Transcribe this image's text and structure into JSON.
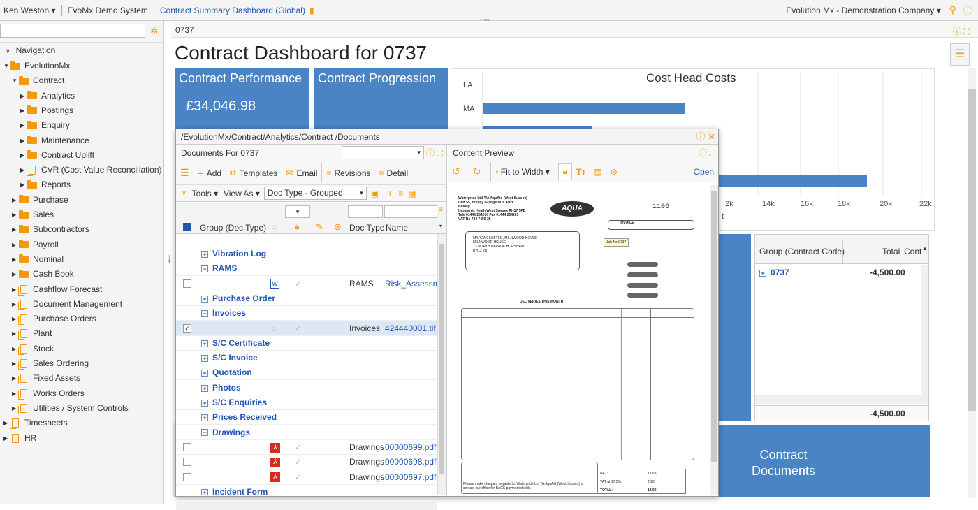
{
  "topbar": {
    "user": "Ken Weston",
    "system": "EvoMx Demo System",
    "dashboard": "Contract Summary Dashboard (Global)",
    "company": "Evolution Mx - Demonstration Company"
  },
  "sidebar": {
    "nav_header": "Navigation",
    "items": [
      {
        "label": "EvolutionMx"
      },
      {
        "label": "Contract"
      },
      {
        "label": "Analytics"
      },
      {
        "label": "Postings"
      },
      {
        "label": "Enquiry"
      },
      {
        "label": "Maintenance"
      },
      {
        "label": "Contract Uplift"
      },
      {
        "label": "CVR (Cost Value Reconciliation)"
      },
      {
        "label": "Reports"
      },
      {
        "label": "Purchase"
      },
      {
        "label": "Sales"
      },
      {
        "label": "Subcontractors"
      },
      {
        "label": "Payroll"
      },
      {
        "label": "Nominal"
      },
      {
        "label": "Cash Book"
      },
      {
        "label": "Cashflow Forecast"
      },
      {
        "label": "Document Management"
      },
      {
        "label": "Purchase Orders"
      },
      {
        "label": "Plant"
      },
      {
        "label": "Stock"
      },
      {
        "label": "Sales Ordering"
      },
      {
        "label": "Fixed Assets"
      },
      {
        "label": "Works Orders"
      },
      {
        "label": "Utilities / System Controls"
      },
      {
        "label": "Timesheets"
      },
      {
        "label": "HR"
      }
    ]
  },
  "main": {
    "breadcrumb": "0737",
    "title": "Contract Dashboard for 0737",
    "tile_performance": "Contract Performance",
    "tile_performance_value": "£34,046.98",
    "tile_progression": "Contract Progression",
    "tile_documents": "Contract\nDocuments",
    "cost_title": "Cost Head Costs",
    "cost_labels": [
      "LA",
      "MA"
    ],
    "cost_ticks": [
      "2k",
      "14k",
      "16k",
      "18k",
      "20k",
      "22k"
    ],
    "cost_partial": "t"
  },
  "right_grid": {
    "col_group": "Group (Contract Code)",
    "col_total": "Total",
    "col_cont": "Cont",
    "row_code": "0737",
    "row_total": "-4,500.00",
    "footer_total": "-4,500.00"
  },
  "docwin": {
    "path": "/EvolutionMx/Contract/Analytics/Contract /Documents",
    "left_title": "Documents For 0737",
    "toolbar": {
      "add": "Add",
      "templates": "Templates",
      "email": "Email",
      "revisions": "Revisions",
      "detail": "Detail"
    },
    "toolbar2": {
      "tools": "Tools",
      "view_as": "View As",
      "doc_type": "Doc Type - Grouped"
    },
    "columns": {
      "group": "Group (Doc Type)",
      "doc_type": "Doc Type",
      "name": "Name"
    },
    "rows": [
      {
        "kind": "group",
        "label": "Vibration Log",
        "sign": "+"
      },
      {
        "kind": "group",
        "label": "RAMS",
        "sign": "−"
      },
      {
        "kind": "doc",
        "doctype": "RAMS",
        "name": "Risk_Assessme",
        "icon": "word"
      },
      {
        "kind": "group",
        "label": "Purchase Order",
        "sign": "+"
      },
      {
        "kind": "group",
        "label": "Invoices",
        "sign": "−"
      },
      {
        "kind": "doc",
        "doctype": "Invoices",
        "name": "424440001.tif",
        "icon": "sync",
        "selected": true
      },
      {
        "kind": "group",
        "label": "S/C Certificate",
        "sign": "+"
      },
      {
        "kind": "group",
        "label": "S/C Invoice",
        "sign": "+"
      },
      {
        "kind": "group",
        "label": "Quotation",
        "sign": "+"
      },
      {
        "kind": "group",
        "label": "Photos",
        "sign": "+"
      },
      {
        "kind": "group",
        "label": "S/C Enquiries",
        "sign": "+"
      },
      {
        "kind": "group",
        "label": "Prices Received",
        "sign": "+"
      },
      {
        "kind": "group",
        "label": "Drawings",
        "sign": "−"
      },
      {
        "kind": "doc",
        "doctype": "Drawings",
        "name": "00000699.pdf",
        "icon": "pdf"
      },
      {
        "kind": "doc",
        "doctype": "Drawings",
        "name": "00000698.pdf",
        "icon": "pdf"
      },
      {
        "kind": "doc",
        "doctype": "Drawings",
        "name": "00000697.pdf",
        "icon": "pdf"
      },
      {
        "kind": "group",
        "label": "Incident Form",
        "sign": "+"
      }
    ],
    "preview_title": "Content Preview",
    "fit": "Fit to Width",
    "open": "Open"
  },
  "invoice": {
    "company_lines": [
      "Waterpride Ltd T/A AquAid (West Sussex)",
      "Unit 55, Bolney Grange Bus. Park",
      "Bolney",
      "Haywards Heath West Sussex RH17 5PB",
      "Tele 01444 254200 Fax 01444 254203",
      "VAT No 744 7455 25"
    ],
    "number": "1106",
    "label": "INVOICE",
    "address": [
      "MARDAK LIMITED, MILNWOOD HOUSE",
      "MILNWOOD HOUSE",
      "13 NORTH PARADE HORSHAM",
      "RH12 2BT"
    ],
    "job": "Job No 0737",
    "deliveries": "DELIVERIES THIS MONTH",
    "footer": "Please make cheques payable to: Waterpride Ltd TA AquAid (West Sussex) or contact our office for BACS payment details",
    "net_label": "NET:",
    "net": "12.68",
    "vat_label": "VAT at 17.5%:",
    "vat": "2.22",
    "total_label": "TOTAL:",
    "total": "14.90"
  }
}
